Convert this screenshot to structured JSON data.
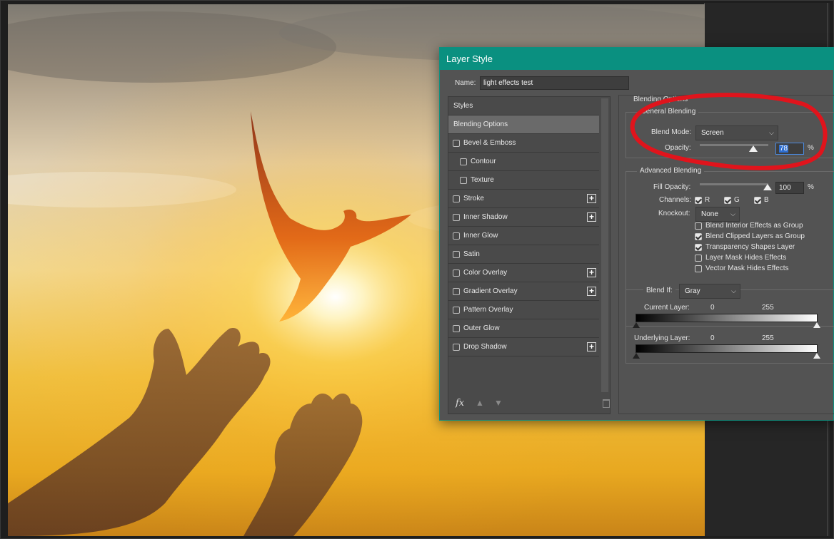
{
  "dialog": {
    "title": "Layer Style",
    "name_label": "Name:",
    "name_value": "light effects test"
  },
  "styles": {
    "header": "Styles",
    "items": [
      {
        "label": "Blending Options",
        "active": true
      },
      {
        "label": "Bevel & Emboss",
        "checked": false
      },
      {
        "label": "Contour",
        "checked": false
      },
      {
        "label": "Texture",
        "checked": false
      },
      {
        "label": "Stroke",
        "checked": false,
        "plus": "+"
      },
      {
        "label": "Inner Shadow",
        "checked": false,
        "plus": "+"
      },
      {
        "label": "Inner Glow",
        "checked": false
      },
      {
        "label": "Satin",
        "checked": false
      },
      {
        "label": "Color Overlay",
        "checked": false,
        "plus": "+"
      },
      {
        "label": "Gradient Overlay",
        "checked": false,
        "plus": "+"
      },
      {
        "label": "Pattern Overlay",
        "checked": false
      },
      {
        "label": "Outer Glow",
        "checked": false
      },
      {
        "label": "Drop Shadow",
        "checked": false,
        "plus": "+"
      }
    ],
    "fx_label": "fx"
  },
  "blending": {
    "section_title": "Blending Options",
    "general_title": "General Blending",
    "blend_mode_label": "Blend Mode:",
    "blend_mode_value": "Screen",
    "opacity_label": "Opacity:",
    "opacity_value": "78",
    "opacity_fraction": 0.78,
    "percent": "%",
    "advanced_title": "Advanced Blending",
    "fill_opacity_label": "Fill Opacity:",
    "fill_opacity_value": "100",
    "fill_opacity_fraction": 1.0,
    "channels_label": "Channels:",
    "channel_r": "R",
    "channel_g": "G",
    "channel_b": "B",
    "knockout_label": "Knockout:",
    "knockout_value": "None",
    "options": [
      {
        "label": "Blend Interior Effects as Group",
        "checked": false
      },
      {
        "label": "Blend Clipped Layers as Group",
        "checked": true
      },
      {
        "label": "Transparency Shapes Layer",
        "checked": true
      },
      {
        "label": "Layer Mask Hides Effects",
        "checked": false
      },
      {
        "label": "Vector Mask Hides Effects",
        "checked": false
      }
    ],
    "blend_if_label": "Blend If:",
    "blend_if_value": "Gray",
    "current_layer_label": "Current Layer:",
    "underlying_layer_label": "Underlying Layer:",
    "range_low": "0",
    "range_high": "255"
  },
  "colors": {
    "titlebar": "#0a9080",
    "annotation": "#e0141c",
    "selection": "#2f6fd1"
  }
}
